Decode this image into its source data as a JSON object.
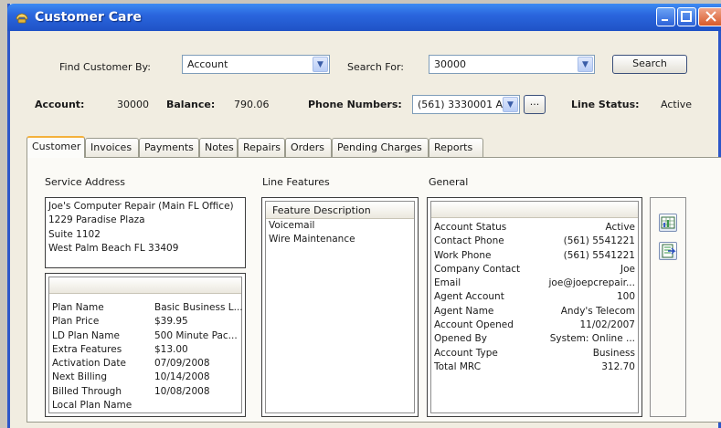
{
  "window": {
    "title": "Customer Care"
  },
  "search": {
    "find_by_label": "Find Customer By:",
    "find_by_value": "Account",
    "search_for_label": "Search For:",
    "search_for_value": "30000",
    "search_button": "Search"
  },
  "summary": {
    "account_label": "Account:",
    "account_value": "30000",
    "balance_label": "Balance:",
    "balance_value": "790.06",
    "phone_label": "Phone Numbers:",
    "phone_value": "(561) 3330001 A",
    "ellipsis_button": "...",
    "line_status_label": "Line Status:",
    "line_status_value": "Active"
  },
  "tabs": [
    "Customer",
    "Invoices",
    "Payments",
    "Notes",
    "Repairs",
    "Orders",
    "Pending Charges",
    "Reports"
  ],
  "service_address": {
    "title": "Service Address",
    "lines": [
      "Joe's Computer Repair (Main FL Office)",
      "1229 Paradise Plaza",
      "Suite 1102",
      "West Palm Beach FL 33409"
    ]
  },
  "plan": {
    "labels": [
      "Plan Name",
      "Plan Price",
      "LD Plan Name",
      "Extra Features",
      "Activation Date",
      "Next Billing",
      "Billed Through",
      "Local Plan Name"
    ],
    "values": [
      "Basic Business L...",
      "$39.95",
      "500 Minute Pac...",
      "$13.00",
      "07/09/2008",
      "10/14/2008",
      "10/08/2008",
      ""
    ]
  },
  "line_features": {
    "title": "Line Features",
    "column_header": "Feature Description",
    "items": [
      "Voicemail",
      "Wire Maintenance"
    ]
  },
  "general": {
    "title": "General",
    "labels": [
      "Account Status",
      "Contact Phone",
      "Work Phone",
      "Company Contact",
      "Email",
      "Agent Account",
      "Agent Name",
      "Account Opened",
      "Opened By",
      "Account Type",
      "Total MRC"
    ],
    "values": [
      "Active",
      "(561) 5541221",
      "(561) 5541221",
      "Joe",
      "joe@joepcrepair...",
      "100",
      "Andy's Telecom",
      "11/02/2007",
      "System: Online ...",
      "Business",
      "312.70"
    ]
  },
  "icons": {
    "title": "phone-app-icon",
    "side_buttons": [
      "grid-chart-icon",
      "export-icon"
    ]
  }
}
